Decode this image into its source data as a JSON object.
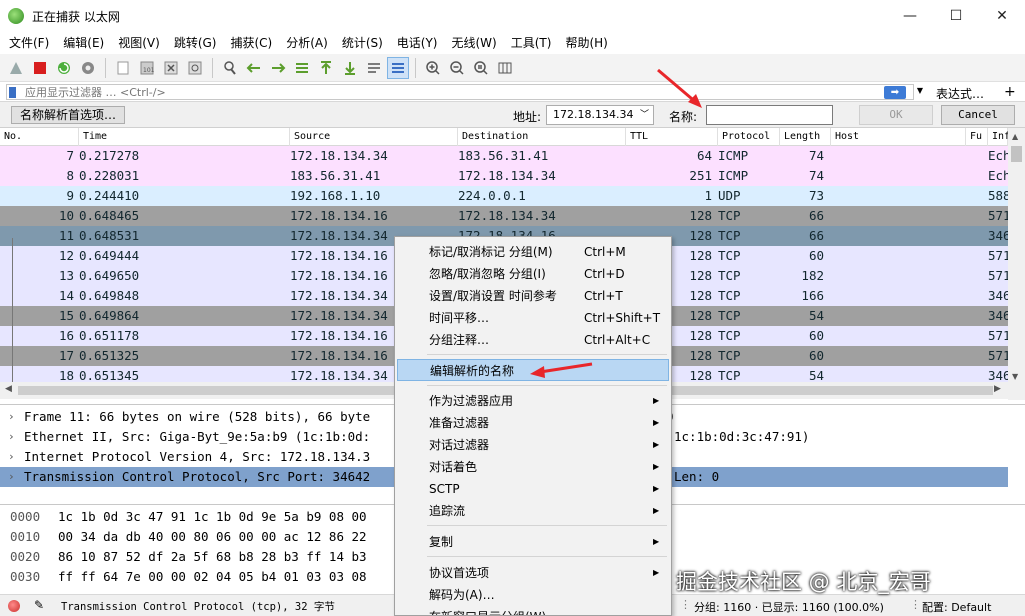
{
  "window": {
    "title": "正在捕获 以太网"
  },
  "window_controls": {
    "minimize": "—",
    "maximize": "☐",
    "close": "✕"
  },
  "menus": [
    "文件(F)",
    "编辑(E)",
    "视图(V)",
    "跳转(G)",
    "捕获(C)",
    "分析(A)",
    "统计(S)",
    "电话(Y)",
    "无线(W)",
    "工具(T)",
    "帮助(H)"
  ],
  "filter": {
    "placeholder": "应用显示过滤器 … <Ctrl-/>",
    "expression_label": "表达式…",
    "plus": "+"
  },
  "name_resolution": {
    "prefs_button": "名称解析首选项…",
    "address_label": "地址:",
    "address_value": "172.18.134.34",
    "name_label": "名称:",
    "name_value": "",
    "ok_label": "OK",
    "cancel_label": "Cancel"
  },
  "packet_list": {
    "columns": [
      "No.",
      "Time",
      "Source",
      "Destination",
      "TTL",
      "Protocol",
      "Length",
      "Host",
      "Fu",
      "Inf"
    ],
    "rows": [
      {
        "no": "7",
        "time": "0.217278",
        "src": "172.18.134.34",
        "dst": "183.56.31.41",
        "ttl": "64",
        "proto": "ICMP",
        "len": "74",
        "info": "Ech",
        "bg": "#fce0ff",
        "fg": "#12272e"
      },
      {
        "no": "8",
        "time": "0.228031",
        "src": "183.56.31.41",
        "dst": "172.18.134.34",
        "ttl": "251",
        "proto": "ICMP",
        "len": "74",
        "info": "Ech",
        "bg": "#fce0ff",
        "fg": "#12272e"
      },
      {
        "no": "9",
        "time": "0.244410",
        "src": "192.168.1.10",
        "dst": "224.0.0.1",
        "ttl": "1",
        "proto": "UDP",
        "len": "73",
        "info": "588",
        "bg": "#daeeff",
        "fg": "#12272e"
      },
      {
        "no": "10",
        "time": "0.648465",
        "src": "172.18.134.16",
        "dst": "172.18.134.34",
        "ttl": "128",
        "proto": "TCP",
        "len": "66",
        "info": "571",
        "bg": "#a0a0a0",
        "fg": "#12272e"
      },
      {
        "no": "11",
        "time": "0.648531",
        "src": "172.18.134.34",
        "dst": "172.18.134.16",
        "ttl": "128",
        "proto": "TCP",
        "len": "66",
        "info": "346",
        "bg": "#7f99ad",
        "fg": "#12272e"
      },
      {
        "no": "12",
        "time": "0.649444",
        "src": "172.18.134.16",
        "dst": "172.18.134.34",
        "ttl": "128",
        "proto": "TCP",
        "len": "60",
        "info": "571",
        "bg": "#e7e6ff",
        "fg": "#12272e"
      },
      {
        "no": "13",
        "time": "0.649650",
        "src": "172.18.134.16",
        "dst": "172.18.134.34",
        "ttl": "128",
        "proto": "TCP",
        "len": "182",
        "info": "571",
        "bg": "#e7e6ff",
        "fg": "#12272e"
      },
      {
        "no": "14",
        "time": "0.649848",
        "src": "172.18.134.34",
        "dst": "172.18.134.16",
        "ttl": "128",
        "proto": "TCP",
        "len": "166",
        "info": "346",
        "bg": "#e7e6ff",
        "fg": "#12272e"
      },
      {
        "no": "15",
        "time": "0.649864",
        "src": "172.18.134.34",
        "dst": "172.18.134.16",
        "ttl": "128",
        "proto": "TCP",
        "len": "54",
        "info": "346",
        "bg": "#a0a0a0",
        "fg": "#12272e"
      },
      {
        "no": "16",
        "time": "0.651178",
        "src": "172.18.134.16",
        "dst": "172.18.134.34",
        "ttl": "128",
        "proto": "TCP",
        "len": "60",
        "info": "571",
        "bg": "#e7e6ff",
        "fg": "#12272e"
      },
      {
        "no": "17",
        "time": "0.651325",
        "src": "172.18.134.16",
        "dst": "172.18.134.34",
        "ttl": "128",
        "proto": "TCP",
        "len": "60",
        "info": "571",
        "bg": "#a0a0a0",
        "fg": "#12272e"
      },
      {
        "no": "18",
        "time": "0.651345",
        "src": "172.18.134.34",
        "dst": "172.18.134.16",
        "ttl": "128",
        "proto": "TCP",
        "len": "54",
        "info": "346",
        "bg": "#e7e6ff",
        "fg": "#12272e"
      }
    ]
  },
  "details": [
    {
      "left": "Frame 11: 66 bytes on wire (528 bits), 66 byte",
      "right": "0",
      "selected": false
    },
    {
      "left": "Ethernet II, Src: Giga-Byt_9e:5a:b9 (1c:1b:0d:",
      "right": "1c:1b:0d:3c:47:91)",
      "selected": false
    },
    {
      "left": "Internet Protocol Version 4, Src: 172.18.134.3",
      "right": "",
      "selected": false
    },
    {
      "left": "Transmission Control Protocol, Src Port: 34642",
      "right": "Len: 0",
      "selected": true
    }
  ],
  "bytes": [
    {
      "offset": "0000",
      "hex": "1c 1b 0d 3c 47 91 1c 1b  0d 9e 5a b9 08 00"
    },
    {
      "offset": "0010",
      "hex": "00 34 da db 40 00 80 06  00 00 ac 12 86 22"
    },
    {
      "offset": "0020",
      "hex": "86 10 87 52 df 2a 5f 68  b8 28 b3 ff 14 b3"
    },
    {
      "offset": "0030",
      "hex": "ff ff 64 7e 00 00 02 04  05 b4 01 03 03 08"
    }
  ],
  "context_menu": {
    "items": [
      {
        "label": "标记/取消标记 分组(M)",
        "shortcut": "Ctrl+M",
        "submenu": false
      },
      {
        "label": "忽略/取消忽略 分组(I)",
        "shortcut": "Ctrl+D",
        "submenu": false
      },
      {
        "label": "设置/取消设置 时间参考",
        "shortcut": "Ctrl+T",
        "submenu": false
      },
      {
        "label": "时间平移…",
        "shortcut": "Ctrl+Shift+T",
        "submenu": false
      },
      {
        "label": "分组注释…",
        "shortcut": "Ctrl+Alt+C",
        "submenu": false
      },
      {
        "label": "编辑解析的名称",
        "shortcut": "",
        "submenu": false,
        "highlighted": true
      },
      {
        "label": "作为过滤器应用",
        "shortcut": "",
        "submenu": true
      },
      {
        "label": "准备过滤器",
        "shortcut": "",
        "submenu": true
      },
      {
        "label": "对话过滤器",
        "shortcut": "",
        "submenu": true
      },
      {
        "label": "对话着色",
        "shortcut": "",
        "submenu": true
      },
      {
        "label": "SCTP",
        "shortcut": "",
        "submenu": true
      },
      {
        "label": "追踪流",
        "shortcut": "",
        "submenu": true
      },
      {
        "label": "复制",
        "shortcut": "",
        "submenu": true
      },
      {
        "label": "协议首选项",
        "shortcut": "",
        "submenu": true
      },
      {
        "label": "解码为(A)…",
        "shortcut": "",
        "submenu": false
      },
      {
        "label": "在新窗口显示分组(W)",
        "shortcut": "",
        "submenu": false
      }
    ]
  },
  "status": {
    "text": "Transmission Control Protocol (tcp), 32 字节",
    "packets": "分组: 1160 · 已显示: 1160 (100.0%)",
    "profile": "配置: Default"
  },
  "watermark": "掘金技术社区 @ 北京_宏哥",
  "colors": {
    "accent": "#3d7bd6",
    "selection": "#7fa1cc",
    "annotation_arrow": "#e8262a"
  }
}
